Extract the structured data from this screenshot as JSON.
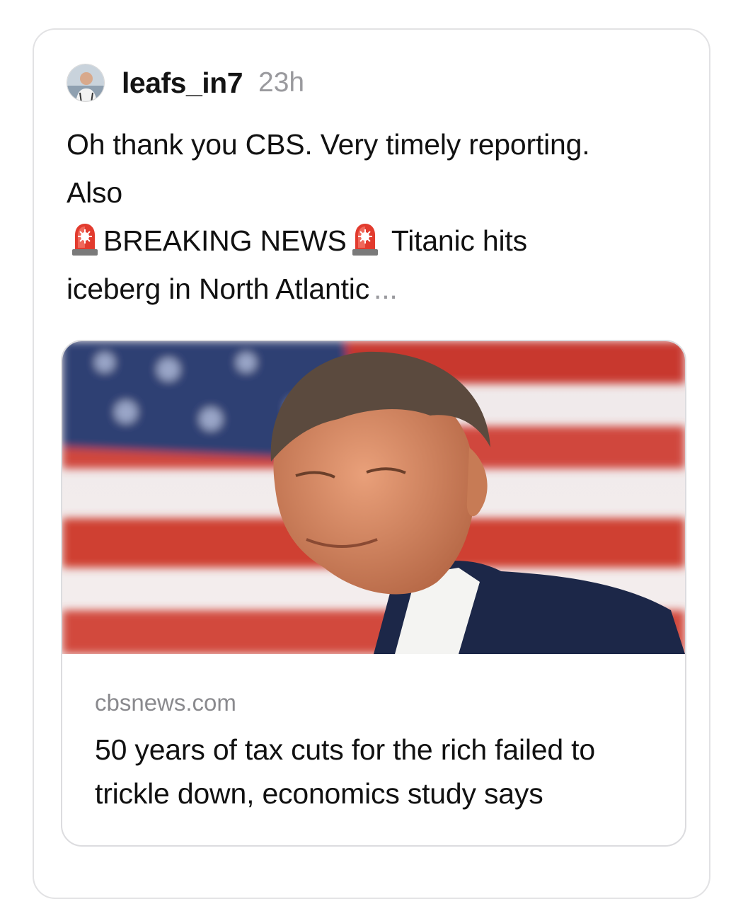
{
  "post": {
    "username": "leafs_in7",
    "timestamp": "23h",
    "text_line1": "Oh thank you CBS. Very timely reporting.",
    "text_line2": "Also",
    "breaking_label": "BREAKING NEWS",
    "text_line3_tail": "Titanic hits",
    "text_line4": "iceberg in North Atlantic",
    "more_indicator": "...",
    "siren_icon": "police-siren-emoji"
  },
  "link_preview": {
    "domain": "cbsnews.com",
    "title": "50 years of tax cuts for the rich failed to trickle down, economics study says",
    "image_description_icon": "news-photo"
  },
  "colors": {
    "text": "#111111",
    "muted": "#9a9a9e",
    "border": "#e2e2e4",
    "flag_red": "#c8372d",
    "flag_blue": "#2f3f73"
  }
}
